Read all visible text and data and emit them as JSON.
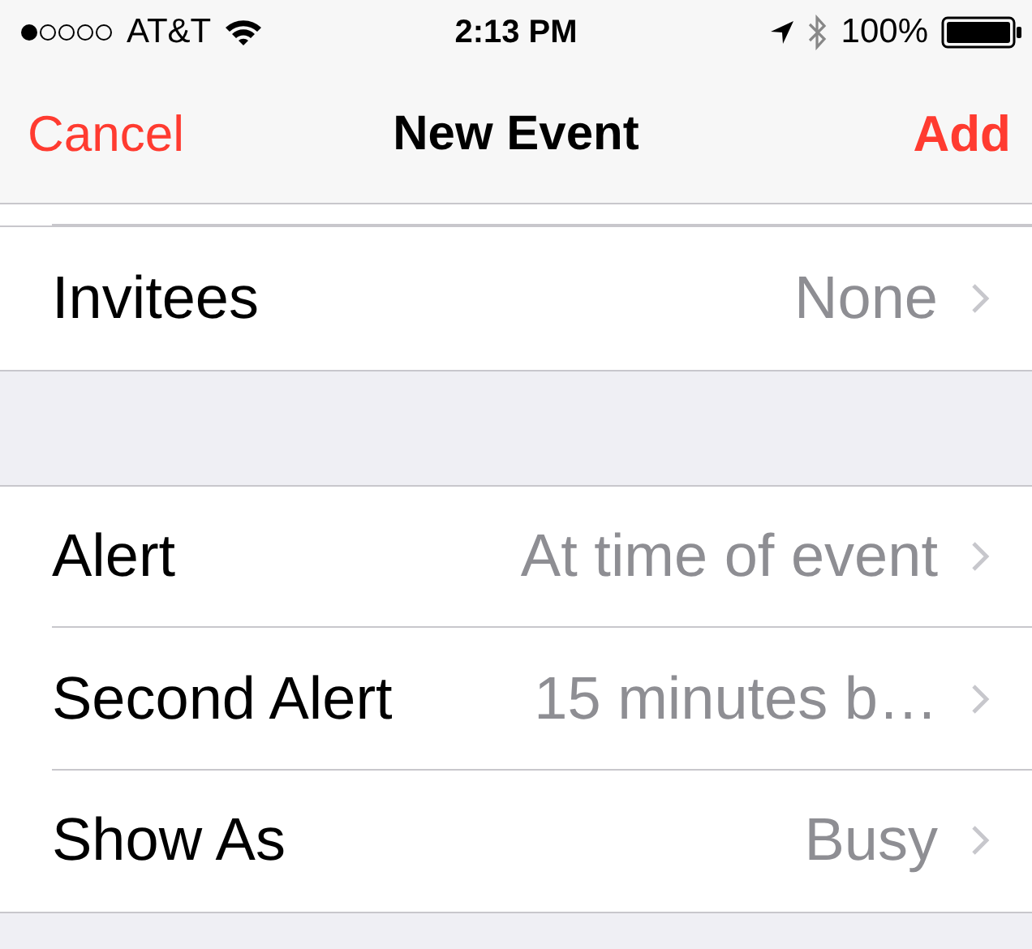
{
  "status_bar": {
    "carrier": "AT&T",
    "time": "2:13 PM",
    "battery": "100%"
  },
  "nav_bar": {
    "cancel": "Cancel",
    "title": "New Event",
    "add": "Add"
  },
  "groups": [
    {
      "rows": [
        {
          "label": "Invitees",
          "value": "None"
        }
      ]
    },
    {
      "rows": [
        {
          "label": "Alert",
          "value": "At time of event"
        },
        {
          "label": "Second Alert",
          "value": "15 minutes b…"
        },
        {
          "label": "Show As",
          "value": "Busy"
        }
      ]
    }
  ]
}
